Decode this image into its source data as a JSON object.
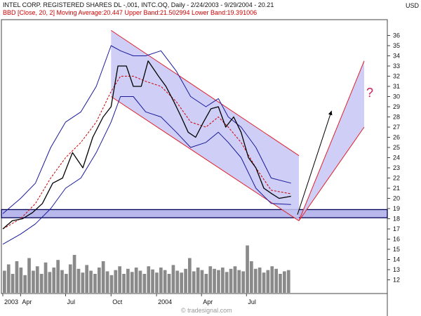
{
  "header": {
    "instrument_line": "INTEL CORP. REGISTERED SHARES DL -,001, INTC.OQ, Daily - 2/24/2003 - 9/29/2004 - 20.21",
    "indicator_line": "BBD [Close, 20, 2] Moving Average:20.447 Upper Band:21.502994 Lower Band:19.391006",
    "currency": "USD",
    "watermark": "© tradesignal.com"
  },
  "colors": {
    "price": "#000000",
    "bands": "#1a1a9a",
    "moving_average": "#cc0000",
    "channel_fill": "#c6c6f4",
    "channel_edge": "#e0202a",
    "support_zone": "#b8b8ec",
    "support_edge": "#000055",
    "volume": "#8a8a8a",
    "question_mark": "#d0205a",
    "arrow": "#000000"
  },
  "annotations": {
    "question_mark": "?"
  },
  "chart_data": {
    "type": "line",
    "title": "INTEL CORP. REGISTERED SHARES DL -,001, INTC.OQ, Daily - 2/24/2003 - 9/29/2004 - 20.21",
    "x_tick_labels": [
      "2003",
      "Apr",
      "Jul",
      "Oct",
      "2004",
      "Apr",
      "Jul"
    ],
    "y_tick_labels": [
      "12",
      "13",
      "14",
      "15",
      "16",
      "17",
      "18",
      "19",
      "20",
      "21",
      "22",
      "23",
      "24",
      "25",
      "26",
      "27",
      "28",
      "29",
      "30",
      "31",
      "32",
      "33",
      "34",
      "35",
      "36"
    ],
    "ylim": [
      11,
      37
    ],
    "ylabel": "USD",
    "legend": [
      "BBD [Close, 20, 2]",
      "Moving Average:20.447",
      "Upper Band:21.502994",
      "Lower Band:19.391006"
    ],
    "series": [
      {
        "name": "INTC.OQ Close",
        "x": [
          "2003-02-24",
          "2003-03-15",
          "2003-04-05",
          "2003-04-25",
          "2003-05-15",
          "2003-06-05",
          "2003-06-25",
          "2003-07-15",
          "2003-08-05",
          "2003-08-25",
          "2003-09-15",
          "2003-10-01",
          "2003-10-15",
          "2003-11-01",
          "2003-11-15",
          "2003-12-01",
          "2003-12-15",
          "2004-01-05",
          "2004-01-20",
          "2004-02-05",
          "2004-02-20",
          "2004-03-05",
          "2004-03-20",
          "2004-04-05",
          "2004-04-20",
          "2004-05-05",
          "2004-05-20",
          "2004-06-05",
          "2004-06-20",
          "2004-07-05",
          "2004-07-20",
          "2004-08-05",
          "2004-08-20",
          "2004-09-05",
          "2004-09-29"
        ],
        "values": [
          17.0,
          17.8,
          18.0,
          18.6,
          19.5,
          21.5,
          22.0,
          24.5,
          23.0,
          26.0,
          28.0,
          29.0,
          33.0,
          33.0,
          31.0,
          31.0,
          33.5,
          32.0,
          31.0,
          29.5,
          28.0,
          26.5,
          26.0,
          27.5,
          28.8,
          29.0,
          27.0,
          28.0,
          26.5,
          24.0,
          23.0,
          21.0,
          20.5,
          20.0,
          20.21
        ]
      },
      {
        "name": "Upper Band",
        "x": [
          "2003-02-24",
          "2003-04-01",
          "2003-05-01",
          "2003-06-01",
          "2003-07-01",
          "2003-08-01",
          "2003-09-01",
          "2003-10-01",
          "2003-10-20",
          "2003-11-15",
          "2003-12-10",
          "2004-01-10",
          "2004-02-10",
          "2004-03-10",
          "2004-04-10",
          "2004-05-05",
          "2004-05-25",
          "2004-06-20",
          "2004-07-20",
          "2004-08-20",
          "2004-09-29"
        ],
        "values": [
          18.5,
          20.0,
          21.5,
          25.0,
          27.5,
          28.5,
          31.0,
          35.0,
          34.5,
          34.0,
          34.0,
          34.5,
          32.5,
          30.0,
          29.0,
          29.8,
          28.0,
          27.0,
          25.0,
          22.0,
          21.5
        ]
      },
      {
        "name": "Lower Band",
        "x": [
          "2003-02-24",
          "2003-04-01",
          "2003-05-01",
          "2003-06-01",
          "2003-07-01",
          "2003-08-01",
          "2003-09-01",
          "2003-10-01",
          "2003-10-20",
          "2003-11-15",
          "2003-12-10",
          "2004-01-10",
          "2004-02-10",
          "2004-03-10",
          "2004-04-10",
          "2004-05-05",
          "2004-05-25",
          "2004-06-20",
          "2004-07-20",
          "2004-08-20",
          "2004-09-29"
        ],
        "values": [
          15.5,
          16.5,
          17.5,
          19.0,
          21.0,
          22.0,
          24.5,
          27.5,
          30.0,
          30.0,
          28.5,
          28.0,
          26.5,
          25.0,
          25.5,
          26.5,
          25.5,
          24.0,
          21.0,
          19.5,
          19.4
        ]
      },
      {
        "name": "Moving Average",
        "x": [
          "2003-02-24",
          "2003-04-01",
          "2003-05-01",
          "2003-06-01",
          "2003-07-01",
          "2003-08-01",
          "2003-09-01",
          "2003-10-01",
          "2003-10-20",
          "2003-11-15",
          "2003-12-10",
          "2004-01-10",
          "2004-02-10",
          "2004-03-10",
          "2004-04-10",
          "2004-05-05",
          "2004-05-25",
          "2004-06-20",
          "2004-07-20",
          "2004-08-20",
          "2004-09-29"
        ],
        "values": [
          17.0,
          18.0,
          19.5,
          22.0,
          24.0,
          25.5,
          27.5,
          30.5,
          32.0,
          32.0,
          31.5,
          31.0,
          29.5,
          27.5,
          27.0,
          28.0,
          27.0,
          25.5,
          23.0,
          20.8,
          20.45
        ]
      }
    ],
    "channel": {
      "upper_line": {
        "x": [
          "2003-10-01",
          "2004-10-15"
        ],
        "values": [
          36.5,
          24.2
        ]
      },
      "lower_line": {
        "x": [
          "2003-10-01",
          "2004-10-15"
        ],
        "values": [
          30.0,
          17.8
        ]
      }
    },
    "projection": {
      "left_edge": {
        "x": [
          "2004-10-15",
          "2005-02-24"
        ],
        "values": [
          17.8,
          33.5
        ]
      },
      "right_edge": {
        "x": [
          "2004-10-15",
          "2005-02-24"
        ],
        "values": [
          17.8,
          27.0
        ]
      },
      "arrow": {
        "x": [
          "2004-10-12",
          "2004-12-20"
        ],
        "values": [
          18.4,
          28.6
        ]
      }
    },
    "support_zone": {
      "values": [
        18.1,
        18.9
      ]
    },
    "volume": {
      "x_range": [
        "2003-02-24",
        "2004-09-29"
      ],
      "levels": [
        0.35,
        0.45,
        0.3,
        0.5,
        0.4,
        0.28,
        0.55,
        0.35,
        0.42,
        0.3,
        0.48,
        0.33,
        0.4,
        0.52,
        0.36,
        0.3,
        0.45,
        0.6,
        0.38,
        0.32,
        0.44,
        0.35,
        0.3,
        0.4,
        0.5,
        0.34,
        0.28,
        0.36,
        0.42,
        0.3,
        0.38,
        0.33,
        0.4,
        0.35,
        0.3,
        0.42,
        0.37,
        0.32,
        0.4,
        0.36,
        0.3,
        0.44,
        0.35,
        0.32,
        0.38,
        0.55,
        0.34,
        0.4,
        0.36,
        0.3,
        0.42,
        0.38,
        0.36,
        0.4,
        0.33,
        0.38,
        0.42,
        0.36,
        0.34,
        0.75,
        0.5,
        0.38,
        0.4,
        0.32,
        0.36,
        0.42,
        0.38,
        0.3,
        0.34,
        0.36
      ]
    }
  }
}
